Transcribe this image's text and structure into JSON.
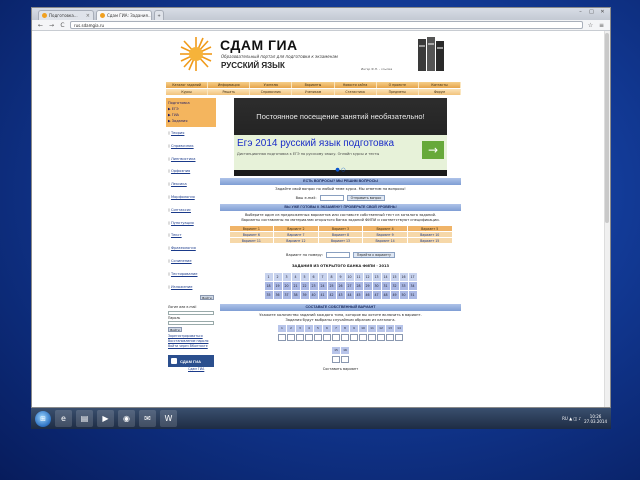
{
  "browser": {
    "tabs": [
      {
        "label": "Подготовка..."
      },
      {
        "label": "Сдам ГИА: Задания..."
      }
    ],
    "new_tab": "+",
    "window_buttons": [
      "–",
      "□",
      "✕"
    ],
    "back": "←",
    "forward": "→",
    "reload": "C",
    "address": "rus.sdamgia.ru"
  },
  "header": {
    "brand": "СДАМ ГИА",
    "tagline": "Образовательный портал для подготовки к экзаменам",
    "subject": "РУССКИЙ ЯЗЫК",
    "small_text": "Ингэр Ф.Н. - ссылка"
  },
  "nav": {
    "row1": [
      "Каталог заданий",
      "Информация",
      "Учителю",
      "Варианты",
      "Новости сайта",
      "О проекте",
      "Контакты"
    ],
    "row2": [
      "Курсы",
      "Решать",
      "Справочник",
      "Ученикам",
      "Статистика",
      "Предметы",
      "Форум"
    ]
  },
  "sidebar": {
    "orange": [
      "Подготовка",
      "▶ ЕГЭ",
      "▶ ГИА",
      "▶ Задания"
    ],
    "links": [
      "Теория",
      "Справочник",
      "Лингвистика",
      "Орфоэпия",
      "Лексика",
      "Морфология",
      "Синтаксис",
      "Пунктуация",
      "Текст",
      "Фразеология",
      "Сочинение",
      "Тестирование",
      "Изложение"
    ],
    "login_button": "Войти",
    "login_label": "Логин или e-mail",
    "password_label": "Пароль",
    "submit_button": "Войти",
    "extra_links": [
      "Зарегистрироваться",
      "Восстановление пароля",
      "Войти через ВКонтакте"
    ],
    "badge": "СДАМ ГИА",
    "badge_sub": "Сдам ГИА"
  },
  "ad": {
    "top_text": "Постоянное посещение занятий необязательно!",
    "headline": "Егэ 2014 русский язык подготовка",
    "subtext": "Дистанционная подготовка к ЕГЭ по русскому языку. Онлайн курсы и тесты",
    "arrow": "→",
    "dots": "● ○"
  },
  "sections": {
    "questions_bar": "ЕСТЬ ВОПРОСЫ? МЫ РЕШИМ ВОПРОСЫ",
    "questions_line": "Задайте свой вопрос по любой теме курса. Мы ответим на вопросы!",
    "email_label": "Ваш e-mail:",
    "email_button": "Отправить вопрос",
    "ready_bar": "ВЫ УЖЕ ГОТОВЫ К ЭКЗАМЕНУ? ПРОВЕРЬТЕ СВОЙ УРОВЕНЬ!",
    "ready_line1": "Выберите один из предложенных вариантов или составьте собственный тест из каталога заданий.",
    "ready_line2": "Варианты составлены по материалам открытого банка заданий ФИПИ и соответствуют спецификации.",
    "variant_label": "Вариант по номеру:",
    "variant_button": "Перейти к варианту",
    "tasks_title": "ЗАДАНИЯ ИЗ ОТКРЫТОГО БАНКА ФИПИ · 2013",
    "own_bar": "СОСТАВЬТЕ СОБСТВЕННЫЙ ВАРИАНТ",
    "own_line1": "Укажите количество заданий каждого типа, которое вы хотите включить в вариант.",
    "own_line2": "Задания будут выбраны случайным образом из каталога.",
    "footer_line": "Составить вариант"
  },
  "variants": {
    "headers": [
      "Вариант 1",
      "Вариант 2",
      "Вариант 3",
      "Вариант 4",
      "Вариант 5"
    ],
    "rows": [
      [
        "Вариант 6",
        "Вариант 7",
        "Вариант 8",
        "Вариант 9",
        "Вариант 10"
      ],
      [
        "Вариант 11",
        "Вариант 12",
        "Вариант 13",
        "Вариант 14",
        "Вариант 15"
      ]
    ]
  },
  "task_grid": {
    "row1": [
      "1",
      "2",
      "3",
      "4",
      "5",
      "6",
      "7",
      "8",
      "9",
      "10",
      "11",
      "12",
      "13",
      "14",
      "15",
      "16",
      "17"
    ],
    "row2": [
      "18",
      "19",
      "20",
      "21",
      "22",
      "23",
      "24",
      "25",
      "26",
      "27",
      "28",
      "29",
      "30",
      "31",
      "32",
      "33",
      "34"
    ],
    "row3": [
      "35",
      "36",
      "37",
      "38",
      "39",
      "40",
      "41",
      "42",
      "43",
      "44",
      "45",
      "46",
      "47",
      "48",
      "49",
      "50",
      "51"
    ]
  },
  "own_cells": {
    "labels": [
      "1",
      "2",
      "3",
      "4",
      "5",
      "6",
      "7",
      "8",
      "9",
      "10",
      "11",
      "12",
      "13",
      "14"
    ],
    "extra_labels": [
      "15",
      "16"
    ]
  },
  "taskbar": {
    "start": "⊞",
    "icons": [
      "e",
      "▤",
      "▶",
      "◉",
      "✉",
      "W"
    ],
    "tray": "RU ▲ ◫ ♪",
    "time": "10:26",
    "date": "27.03.2014"
  },
  "colors": {
    "accent_orange": "#f0b468",
    "accent_blue": "#7f9ed4",
    "desktop_blue": "#123a96"
  }
}
